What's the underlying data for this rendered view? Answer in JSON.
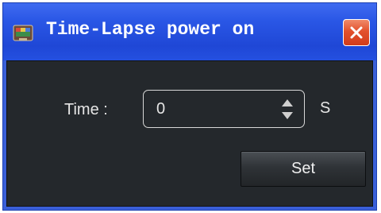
{
  "window": {
    "title": "Time-Lapse power on",
    "app_icon": "app-icon",
    "close_icon": "close-icon"
  },
  "form": {
    "time_label": "Time :",
    "time_value": "0",
    "unit_label": "S",
    "spin_up_icon": "chevron-up-icon",
    "spin_down_icon": "chevron-down-icon",
    "set_button_label": "Set"
  },
  "colors": {
    "titlebar": "#2450e0",
    "client_background": "#24282c",
    "close_button": "#e2512c",
    "text": "#e6e6e6"
  }
}
